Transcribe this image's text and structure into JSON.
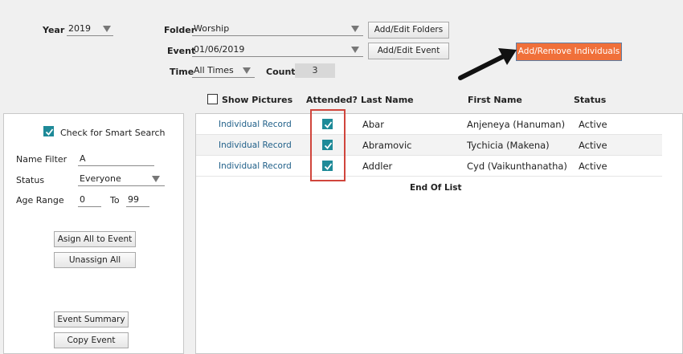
{
  "header": {
    "year_label": "Year",
    "year_value": "2019",
    "folder_label": "Folder",
    "folder_value": "Worship",
    "event_label": "Event",
    "event_value": "01/06/2019",
    "time_label": "Time",
    "time_value": "All Times",
    "count_label": "Count",
    "count_value": "3",
    "add_edit_folders": "Add/Edit Folders",
    "add_edit_event": "Add/Edit Event",
    "add_remove_individuals": "Add/Remove Individuals"
  },
  "filters": {
    "smart_search_label": "Check for Smart Search",
    "smart_search_checked": true,
    "name_filter_label": "Name Filter",
    "name_filter_value": "A",
    "status_label": "Status",
    "status_value": "Everyone",
    "age_range_label": "Age Range",
    "age_from": "0",
    "age_to_label": "To",
    "age_to": "99",
    "assign_all": "Asign All to Event",
    "unassign_all": "Unassign All",
    "event_summary": "Event Summary",
    "copy_event": "Copy Event"
  },
  "table": {
    "show_pictures_label": "Show Pictures",
    "show_pictures_checked": false,
    "columns": {
      "attended": "Attended?",
      "last_name": "Last Name",
      "first_name": "First Name",
      "status": "Status"
    },
    "rows": [
      {
        "link": "Individual Record",
        "attended": true,
        "last_name": "Abar",
        "first_name": "Anjeneya (Hanuman)",
        "status": "Active"
      },
      {
        "link": "Individual Record",
        "attended": true,
        "last_name": "Abramovic",
        "first_name": "Tychicia (Makena)",
        "status": "Active"
      },
      {
        "link": "Individual Record",
        "attended": true,
        "last_name": "Addler",
        "first_name": "Cyd (Vaikunthanatha)",
        "status": "Active"
      }
    ],
    "end_of_list": "End Of List"
  },
  "colors": {
    "accent_orange": "#f0703a",
    "checkbox_teal": "#1e8a98",
    "highlight_red": "#d0453c",
    "link_blue": "#1f5f88"
  }
}
